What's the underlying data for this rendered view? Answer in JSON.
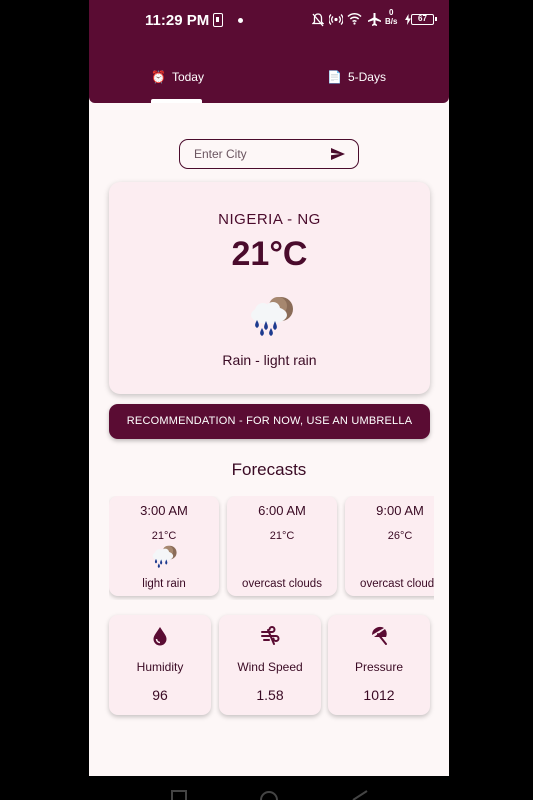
{
  "status_bar": {
    "time": "11:29 PM",
    "speed_top": "0",
    "speed_unit": "B/s",
    "battery": "67"
  },
  "tabs": [
    {
      "icon": "alarm-clock-icon",
      "label": "Today",
      "selected": true
    },
    {
      "icon": "document-icon",
      "label": "5-Days",
      "selected": false
    }
  ],
  "search": {
    "placeholder": "Enter City",
    "value": ""
  },
  "current": {
    "location": "NIGERIA - NG",
    "temperature": "21°C",
    "icon": "rain-cloud-icon",
    "description": "Rain - light rain"
  },
  "recommendation": "RECOMMENDATION - FOR NOW, USE AN UMBRELLA",
  "forecasts_title": "Forecasts",
  "forecasts": [
    {
      "time": "3:00 AM",
      "temp": "21°C",
      "icon": "rain-cloud-icon",
      "desc": "light rain"
    },
    {
      "time": "6:00 AM",
      "temp": "21°C",
      "icon": "",
      "desc": "overcast clouds"
    },
    {
      "time": "9:00 AM",
      "temp": "26°C",
      "icon": "",
      "desc": "overcast clouds"
    }
  ],
  "stats": [
    {
      "icon": "water-drop-icon",
      "label": "Humidity",
      "value": "96"
    },
    {
      "icon": "wind-icon",
      "label": "Wind Speed",
      "value": "1.58"
    },
    {
      "icon": "umbrella-icon",
      "label": "Pressure",
      "value": "1012"
    }
  ],
  "colors": {
    "primary": "#5a0c33",
    "background": "#fdf7f7",
    "card": "#fcedf1",
    "text": "#3a0a24"
  }
}
